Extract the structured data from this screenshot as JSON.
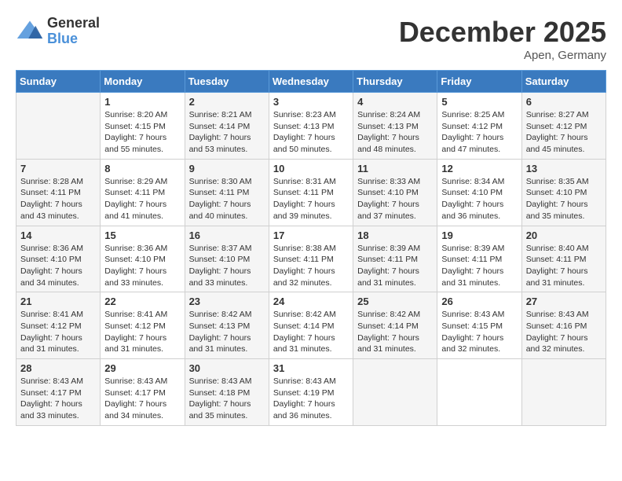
{
  "logo": {
    "general": "General",
    "blue": "Blue"
  },
  "title": "December 2025",
  "location": "Apen, Germany",
  "days_of_week": [
    "Sunday",
    "Monday",
    "Tuesday",
    "Wednesday",
    "Thursday",
    "Friday",
    "Saturday"
  ],
  "weeks": [
    [
      {
        "day": "",
        "content": ""
      },
      {
        "day": "1",
        "content": "Sunrise: 8:20 AM\nSunset: 4:15 PM\nDaylight: 7 hours\nand 55 minutes."
      },
      {
        "day": "2",
        "content": "Sunrise: 8:21 AM\nSunset: 4:14 PM\nDaylight: 7 hours\nand 53 minutes."
      },
      {
        "day": "3",
        "content": "Sunrise: 8:23 AM\nSunset: 4:13 PM\nDaylight: 7 hours\nand 50 minutes."
      },
      {
        "day": "4",
        "content": "Sunrise: 8:24 AM\nSunset: 4:13 PM\nDaylight: 7 hours\nand 48 minutes."
      },
      {
        "day": "5",
        "content": "Sunrise: 8:25 AM\nSunset: 4:12 PM\nDaylight: 7 hours\nand 47 minutes."
      },
      {
        "day": "6",
        "content": "Sunrise: 8:27 AM\nSunset: 4:12 PM\nDaylight: 7 hours\nand 45 minutes."
      }
    ],
    [
      {
        "day": "7",
        "content": "Sunrise: 8:28 AM\nSunset: 4:11 PM\nDaylight: 7 hours\nand 43 minutes."
      },
      {
        "day": "8",
        "content": "Sunrise: 8:29 AM\nSunset: 4:11 PM\nDaylight: 7 hours\nand 41 minutes."
      },
      {
        "day": "9",
        "content": "Sunrise: 8:30 AM\nSunset: 4:11 PM\nDaylight: 7 hours\nand 40 minutes."
      },
      {
        "day": "10",
        "content": "Sunrise: 8:31 AM\nSunset: 4:11 PM\nDaylight: 7 hours\nand 39 minutes."
      },
      {
        "day": "11",
        "content": "Sunrise: 8:33 AM\nSunset: 4:10 PM\nDaylight: 7 hours\nand 37 minutes."
      },
      {
        "day": "12",
        "content": "Sunrise: 8:34 AM\nSunset: 4:10 PM\nDaylight: 7 hours\nand 36 minutes."
      },
      {
        "day": "13",
        "content": "Sunrise: 8:35 AM\nSunset: 4:10 PM\nDaylight: 7 hours\nand 35 minutes."
      }
    ],
    [
      {
        "day": "14",
        "content": "Sunrise: 8:36 AM\nSunset: 4:10 PM\nDaylight: 7 hours\nand 34 minutes."
      },
      {
        "day": "15",
        "content": "Sunrise: 8:36 AM\nSunset: 4:10 PM\nDaylight: 7 hours\nand 33 minutes."
      },
      {
        "day": "16",
        "content": "Sunrise: 8:37 AM\nSunset: 4:10 PM\nDaylight: 7 hours\nand 33 minutes."
      },
      {
        "day": "17",
        "content": "Sunrise: 8:38 AM\nSunset: 4:11 PM\nDaylight: 7 hours\nand 32 minutes."
      },
      {
        "day": "18",
        "content": "Sunrise: 8:39 AM\nSunset: 4:11 PM\nDaylight: 7 hours\nand 31 minutes."
      },
      {
        "day": "19",
        "content": "Sunrise: 8:39 AM\nSunset: 4:11 PM\nDaylight: 7 hours\nand 31 minutes."
      },
      {
        "day": "20",
        "content": "Sunrise: 8:40 AM\nSunset: 4:11 PM\nDaylight: 7 hours\nand 31 minutes."
      }
    ],
    [
      {
        "day": "21",
        "content": "Sunrise: 8:41 AM\nSunset: 4:12 PM\nDaylight: 7 hours\nand 31 minutes."
      },
      {
        "day": "22",
        "content": "Sunrise: 8:41 AM\nSunset: 4:12 PM\nDaylight: 7 hours\nand 31 minutes."
      },
      {
        "day": "23",
        "content": "Sunrise: 8:42 AM\nSunset: 4:13 PM\nDaylight: 7 hours\nand 31 minutes."
      },
      {
        "day": "24",
        "content": "Sunrise: 8:42 AM\nSunset: 4:14 PM\nDaylight: 7 hours\nand 31 minutes."
      },
      {
        "day": "25",
        "content": "Sunrise: 8:42 AM\nSunset: 4:14 PM\nDaylight: 7 hours\nand 31 minutes."
      },
      {
        "day": "26",
        "content": "Sunrise: 8:43 AM\nSunset: 4:15 PM\nDaylight: 7 hours\nand 32 minutes."
      },
      {
        "day": "27",
        "content": "Sunrise: 8:43 AM\nSunset: 4:16 PM\nDaylight: 7 hours\nand 32 minutes."
      }
    ],
    [
      {
        "day": "28",
        "content": "Sunrise: 8:43 AM\nSunset: 4:17 PM\nDaylight: 7 hours\nand 33 minutes."
      },
      {
        "day": "29",
        "content": "Sunrise: 8:43 AM\nSunset: 4:17 PM\nDaylight: 7 hours\nand 34 minutes."
      },
      {
        "day": "30",
        "content": "Sunrise: 8:43 AM\nSunset: 4:18 PM\nDaylight: 7 hours\nand 35 minutes."
      },
      {
        "day": "31",
        "content": "Sunrise: 8:43 AM\nSunset: 4:19 PM\nDaylight: 7 hours\nand 36 minutes."
      },
      {
        "day": "",
        "content": ""
      },
      {
        "day": "",
        "content": ""
      },
      {
        "day": "",
        "content": ""
      }
    ]
  ]
}
